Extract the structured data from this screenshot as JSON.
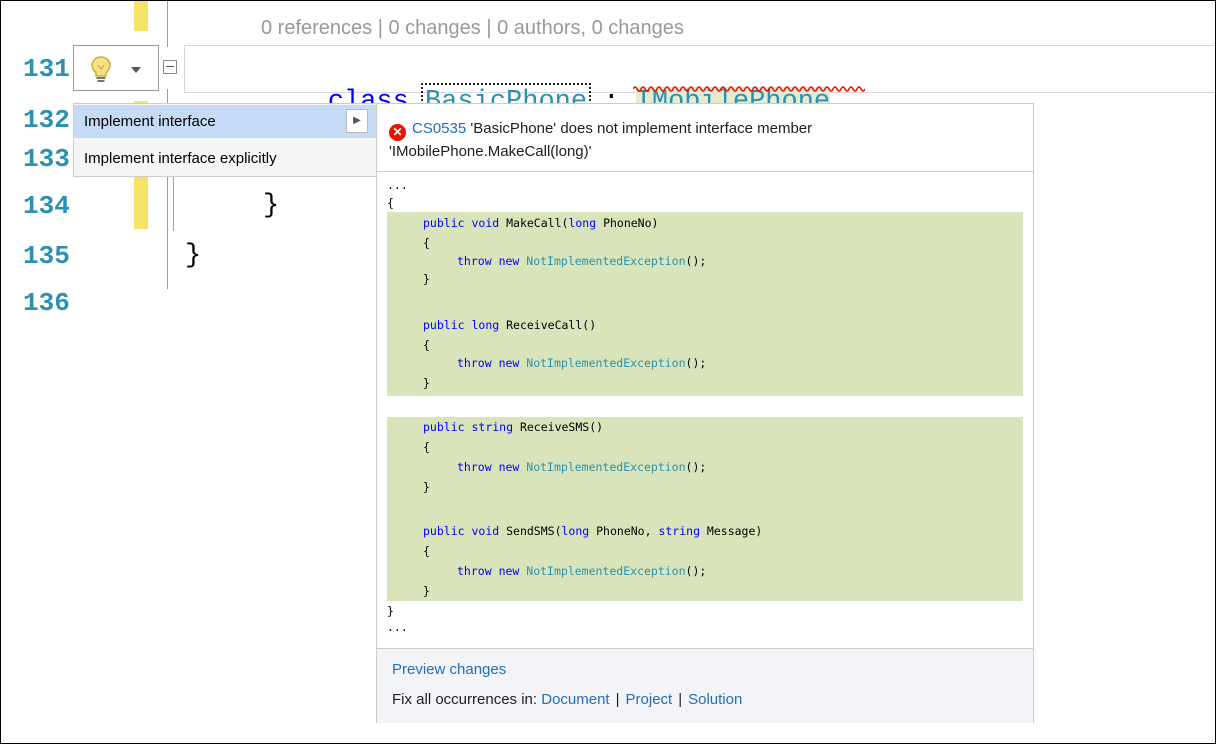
{
  "editor": {
    "codelens": "0 references | 0 changes | 0 authors, 0 changes",
    "line_numbers": [
      "131",
      "132",
      "133",
      "134",
      "135",
      "136"
    ],
    "class_keyword": "class",
    "class_name": "BasicPhone",
    "colon": ":",
    "interface_name": "IMobilePhone",
    "close_brace_inner": "}",
    "close_brace_outer": "}"
  },
  "quick_actions_menu": {
    "items": [
      {
        "label": "Implement interface",
        "selected": true
      },
      {
        "label": "Implement interface explicitly",
        "selected": false
      }
    ]
  },
  "preview": {
    "error_code": "CS0535",
    "error_message": "'BasicPhone' does not implement interface member 'IMobilePhone.MakeCall(long)'",
    "ellipsis_top": "...",
    "open_brace": "{",
    "m1_sig": "public void MakeCall(long PhoneNo)",
    "m1_open": "{",
    "m1_body": "throw new NotImplementedException();",
    "m1_close": "}",
    "m2_sig": "public long ReceiveCall()",
    "m2_open": "{",
    "m2_body": "throw new NotImplementedException();",
    "m2_close": "}",
    "m3_sig": "public string ReceiveSMS()",
    "m3_open": "{",
    "m3_body": "throw new NotImplementedException();",
    "m3_close": "}",
    "m4_sig": "public void SendSMS(long PhoneNo, string Message)",
    "m4_open": "{",
    "m4_body": "throw new NotImplementedException();",
    "m4_close": "}",
    "close_brace": "}",
    "ellipsis_bottom": "...",
    "preview_changes_label": "Preview changes",
    "fix_all_label": "Fix all occurrences in:",
    "fix_document": "Document",
    "fix_project": "Project",
    "fix_solution": "Solution",
    "separator": "|"
  },
  "colors": {
    "keyword": "#0000ff",
    "type": "#2b91af",
    "added_code_bg": "#d9e4bb",
    "selected_menu_bg": "#c6dbf5",
    "error_icon": "#e51400",
    "link": "#1f6fb8",
    "change_margin": "#f5e36a"
  }
}
